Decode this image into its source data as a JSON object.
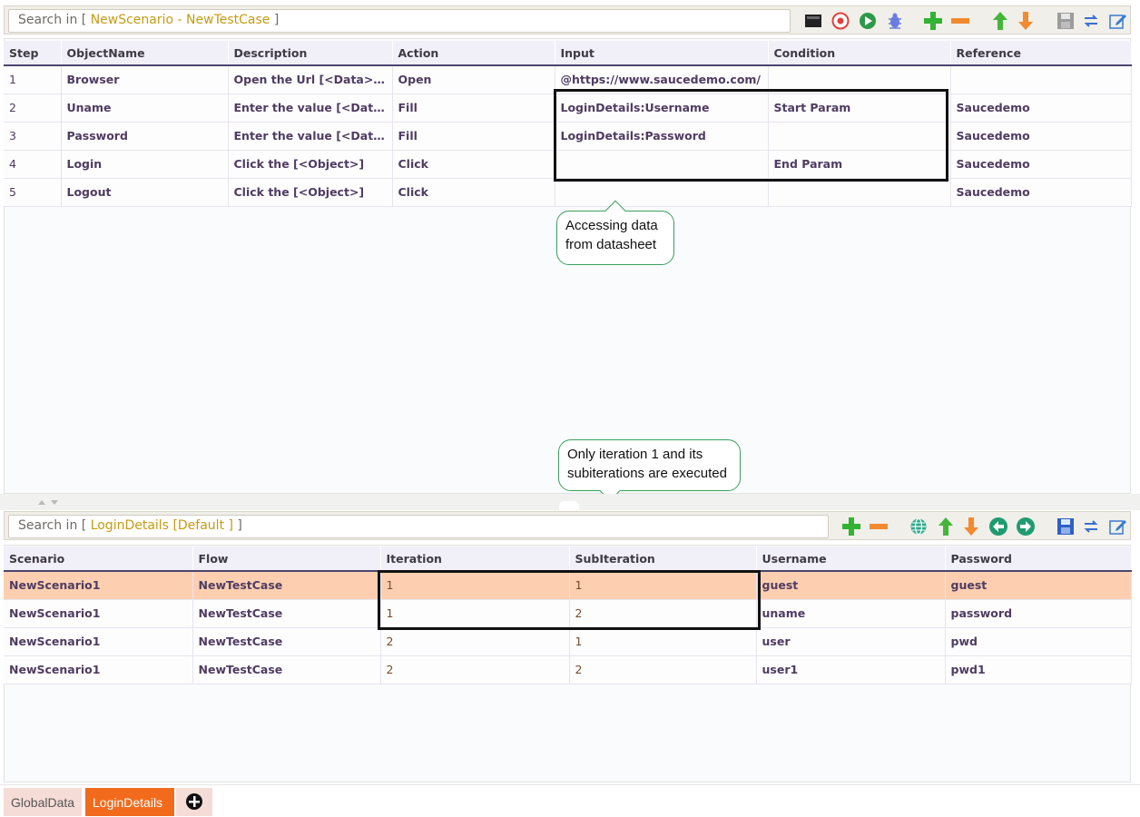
{
  "top_toolbar": {
    "search_prefix": "Search in [ ",
    "search_scope": "NewScenario - NewTestCase",
    "search_suffix": " ]"
  },
  "steps_table": {
    "columns": [
      "Step",
      "ObjectName",
      "Description",
      "Action",
      "Input",
      "Condition",
      "Reference"
    ],
    "rows": [
      [
        "1",
        "Browser",
        "Open the Url [<Data>] in t...",
        "Open",
        "@https://www.saucedemo.com/",
        "",
        ""
      ],
      [
        "2",
        "Uname",
        "Enter the value [<Data>] i...",
        "Fill",
        "LoginDetails:Username",
        "Start Param",
        "Saucedemo"
      ],
      [
        "3",
        "Password",
        "Enter the value [<Data>] i...",
        "Fill",
        "LoginDetails:Password",
        "",
        "Saucedemo"
      ],
      [
        "4",
        "Login",
        "Click the [<Object>]",
        "Click",
        "",
        "End Param",
        "Saucedemo"
      ],
      [
        "5",
        "Logout",
        "Click the [<Object>]",
        "Click",
        "",
        "",
        "Saucedemo"
      ]
    ]
  },
  "callouts": {
    "first_line1": "Accessing data",
    "first_line2": "from datasheet",
    "second_line1": "Only iteration 1 and its",
    "second_line2": "subiterations are executed"
  },
  "bottom_toolbar": {
    "search_prefix": "Search in [ ",
    "search_scope": "LoginDetails [Default ]",
    "search_suffix": " ]"
  },
  "data_table": {
    "columns": [
      "Scenario",
      "Flow",
      "Iteration",
      "SubIteration",
      "Username",
      "Password"
    ],
    "rows": [
      [
        "NewScenario1",
        "NewTestCase",
        "1",
        "1",
        "guest",
        "guest"
      ],
      [
        "NewScenario1",
        "NewTestCase",
        "1",
        "2",
        "uname",
        "password"
      ],
      [
        "NewScenario1",
        "NewTestCase",
        "2",
        "1",
        "user",
        "pwd"
      ],
      [
        "NewScenario1",
        "NewTestCase",
        "2",
        "2",
        "user1",
        "pwd1"
      ]
    ]
  },
  "sheet_tabs": {
    "global": "GlobalData",
    "login": "LoginDetails"
  },
  "colors": {
    "accent_orange": "#f26b1d",
    "scope_gold": "#c79a13",
    "selected_row": "#fdcfb0",
    "callout_border": "#3aa05c"
  }
}
